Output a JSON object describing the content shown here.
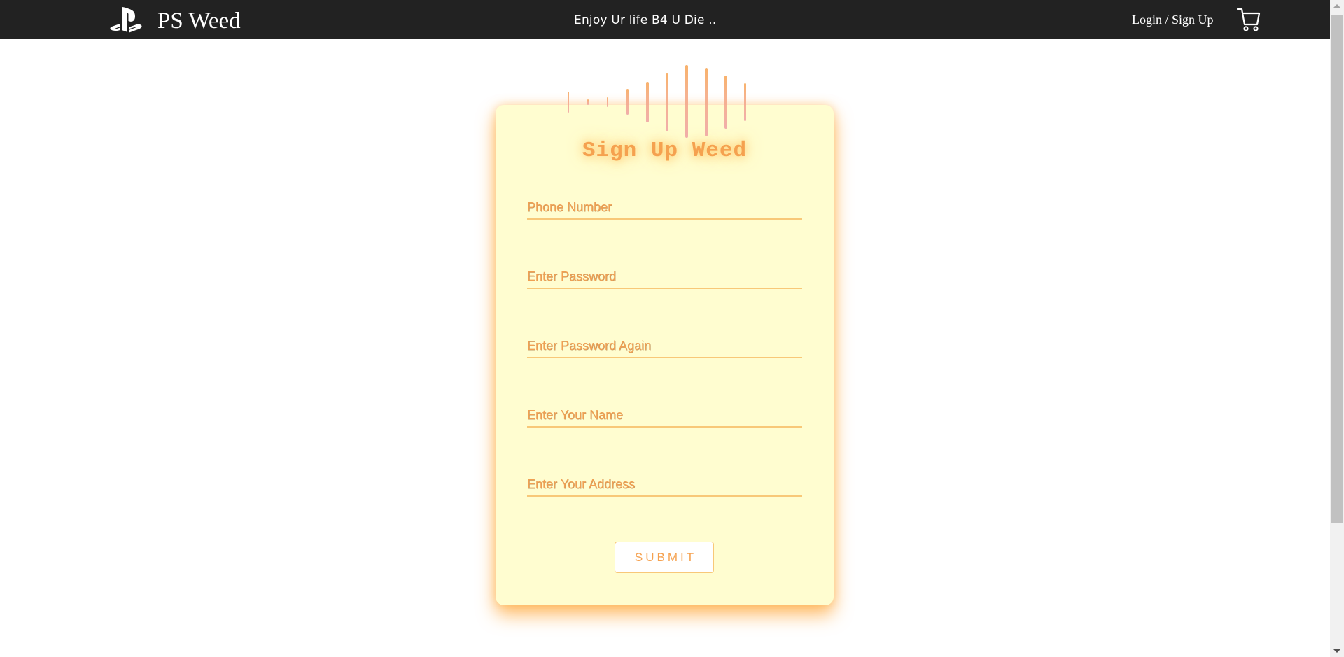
{
  "nav": {
    "brand_name": "PS Weed",
    "tagline": "Enjoy Ur life B4 U Die ..",
    "login_label": "Login / Sign Up"
  },
  "signup": {
    "title": "Sign Up Weed",
    "phone_placeholder": "Phone Number",
    "password_placeholder": "Enter Password",
    "password_again_placeholder": "Enter Password Again",
    "name_placeholder": "Enter Your Name",
    "address_placeholder": "Enter Your Address",
    "submit_label": "SUBMIT"
  },
  "icons": {
    "brand_logo": "playstation-icon",
    "cart": "shopping-cart-icon",
    "equalizer": "equalizer-bars"
  },
  "colors": {
    "navbar_background": "#222222",
    "card_background": "#fffdd0",
    "accent_orange": "#f5a14f",
    "field_underline": "#f8c878"
  }
}
